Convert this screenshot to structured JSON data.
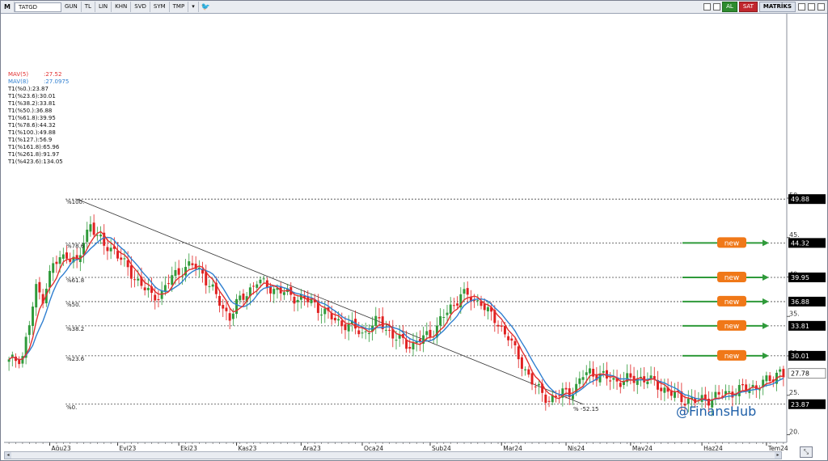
{
  "toolbar": {
    "m_label": "M",
    "symbol": "TATGD",
    "period": "GUN",
    "currency": "TL",
    "scale": "LIN",
    "items": [
      "KHN",
      "SVD",
      "SYM",
      "TMP"
    ],
    "al": "AL",
    "sat": "SAT",
    "matriks": "MATRİKS"
  },
  "chart_data": {
    "type": "candlestick",
    "title": "",
    "ylim": [
      20,
      52
    ],
    "yticks": [
      20,
      25,
      30,
      35,
      40,
      45,
      50
    ],
    "ytick_labels": [
      "20.",
      "25.",
      "30.",
      "35.",
      "40.",
      "45.",
      "50."
    ],
    "month_labels": [
      "Ağu23",
      "Eyl23",
      "Eki23",
      "Kas23",
      "Ara23",
      "Oca24",
      "Şub24",
      "Mar24",
      "Nis24",
      "May24",
      "Haz24",
      "Tem24"
    ],
    "month_bar_index": [
      12,
      32,
      50,
      67,
      86,
      104,
      124,
      145,
      164,
      183,
      204,
      223
    ],
    "close_path": [
      [
        0,
        29.2
      ],
      [
        4,
        30.0
      ],
      [
        6,
        34.0
      ],
      [
        8,
        38.5
      ],
      [
        10,
        37.5
      ],
      [
        13,
        41.5
      ],
      [
        17,
        43.0
      ],
      [
        20,
        41.5
      ],
      [
        22,
        44.5
      ],
      [
        24,
        47.0
      ],
      [
        26,
        45.0
      ],
      [
        28,
        44.0
      ],
      [
        31,
        43.5
      ],
      [
        34,
        41.5
      ],
      [
        37,
        40.0
      ],
      [
        40,
        38.5
      ],
      [
        42,
        37.5
      ],
      [
        45,
        38.0
      ],
      [
        48,
        40.0
      ],
      [
        51,
        41.0
      ],
      [
        54,
        41.5
      ],
      [
        57,
        40.5
      ],
      [
        59,
        39.0
      ],
      [
        61,
        37.5
      ],
      [
        63,
        36.0
      ],
      [
        65,
        35.0
      ],
      [
        67,
        36.5
      ],
      [
        70,
        38.0
      ],
      [
        73,
        39.5
      ],
      [
        75,
        39.0
      ],
      [
        78,
        38.5
      ],
      [
        81,
        38.0
      ],
      [
        84,
        37.5
      ],
      [
        87,
        37.2
      ],
      [
        90,
        36.5
      ],
      [
        93,
        35.5
      ],
      [
        96,
        34.5
      ],
      [
        99,
        34.0
      ],
      [
        102,
        33.5
      ],
      [
        104,
        32.8
      ],
      [
        106,
        33.5
      ],
      [
        109,
        34.5
      ],
      [
        111,
        33.5
      ],
      [
        113,
        32.5
      ],
      [
        115,
        32.0
      ],
      [
        117,
        31.5
      ],
      [
        119,
        31.5
      ],
      [
        121,
        32.0
      ],
      [
        123,
        32.5
      ],
      [
        125,
        33.0
      ],
      [
        127,
        34.5
      ],
      [
        129,
        35.5
      ],
      [
        131,
        36.5
      ],
      [
        133,
        38.0
      ],
      [
        135,
        37.5
      ],
      [
        137,
        36.8
      ],
      [
        139,
        37.0
      ],
      [
        141,
        35.5
      ],
      [
        143,
        34.5
      ],
      [
        145,
        33.5
      ],
      [
        147,
        32.5
      ],
      [
        149,
        30.5
      ],
      [
        151,
        29.0
      ],
      [
        153,
        27.5
      ],
      [
        155,
        26.0
      ],
      [
        157,
        25.2
      ],
      [
        159,
        24.5
      ],
      [
        161,
        24.8
      ],
      [
        163,
        25.3
      ],
      [
        165,
        25.5
      ],
      [
        167,
        26.0
      ],
      [
        169,
        27.5
      ],
      [
        171,
        28.0
      ],
      [
        174,
        27.5
      ],
      [
        177,
        27.0
      ],
      [
        180,
        26.8
      ],
      [
        183,
        27.0
      ],
      [
        186,
        27.2
      ],
      [
        188,
        27.0
      ],
      [
        190,
        26.5
      ],
      [
        192,
        26.0
      ],
      [
        194,
        25.5
      ],
      [
        196,
        25.0
      ],
      [
        198,
        24.5
      ],
      [
        200,
        24.5
      ],
      [
        202,
        24.2
      ],
      [
        205,
        24.5
      ],
      [
        208,
        24.8
      ],
      [
        211,
        25.2
      ],
      [
        214,
        25.6
      ],
      [
        217,
        25.8
      ],
      [
        220,
        26.2
      ],
      [
        223,
        26.7
      ],
      [
        225,
        27.2
      ],
      [
        227,
        28.3
      ],
      [
        228,
        27.8
      ]
    ],
    "mav5": {
      "label": "MAV(5)",
      "value": ":27.52",
      "color": "#e23030"
    },
    "mav8": {
      "label": "MAV(8)",
      "value": ":27.0975",
      "color": "#2f7fd0"
    },
    "fib_legend": [
      "T1(%0.):23.87",
      "T1(%23.6):30.01",
      "T1(%38.2):33.81",
      "T1(%50.):36.88",
      "T1(%61.8):39.95",
      "T1(%78.6):44.32",
      "T1(%100.):49.88",
      "T1(%127.):56.9",
      "T1(%161.8):65.96",
      "T1(%261.8):91.97",
      "T1(%423.6):134.05"
    ],
    "fib_levels": [
      {
        "pct": "%100.",
        "value": 49.88,
        "price_label": "49.88",
        "new": false
      },
      {
        "pct": "%78.6",
        "value": 44.32,
        "price_label": "44.32",
        "new": true
      },
      {
        "pct": "%61.8",
        "value": 39.95,
        "price_label": "39.95",
        "new": true
      },
      {
        "pct": "%50.",
        "value": 36.88,
        "price_label": "36.88",
        "new": true
      },
      {
        "pct": "%38.2",
        "value": 33.81,
        "price_label": "33.81",
        "new": true
      },
      {
        "pct": "%23.6",
        "value": 30.01,
        "price_label": "30.01",
        "new": true
      },
      {
        "pct": "%0.",
        "value": 23.87,
        "price_label": "23.87",
        "new": false
      }
    ],
    "last_price_label": "27.78",
    "last_price": 27.78,
    "trendline_label": "% -52.15",
    "trendline_from": {
      "bar": 20,
      "price": 49.88
    },
    "trendline_to": {
      "bar": 169,
      "price": 23.87
    },
    "new_badge_label": "new",
    "watermark": "@FinansHub",
    "colors": {
      "up": "#2f9a3a",
      "down": "#e02020",
      "mav5": "#e23030",
      "mav8": "#2f7fd0",
      "badge": "#f07818",
      "arrow": "#2f9a3a",
      "watermark": "#1e5fa8"
    }
  }
}
